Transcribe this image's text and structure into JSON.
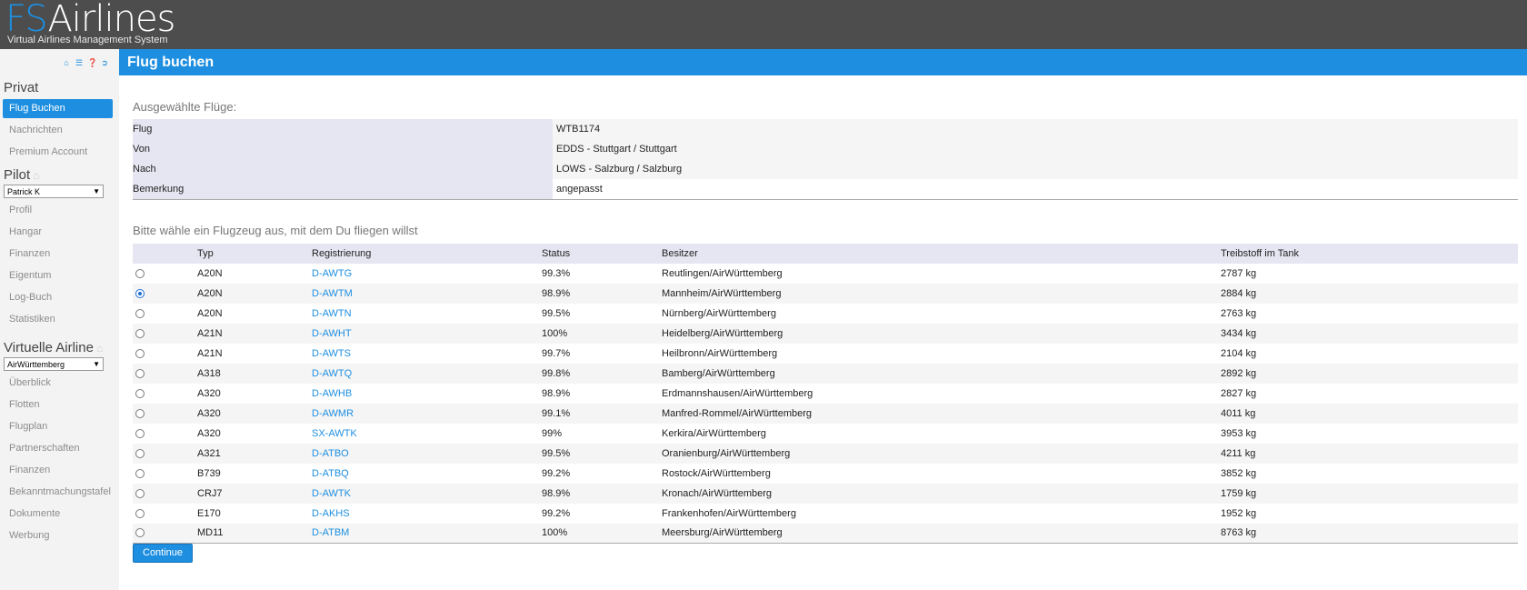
{
  "brand": {
    "prefix": "FS",
    "name": "Airlines",
    "subtitle": "Virtual Airlines Management System"
  },
  "sidebar": {
    "icons": [
      "home-icon",
      "chat-icon",
      "help-icon",
      "logout-icon"
    ],
    "private_title": "Privat",
    "private_items": [
      {
        "label": "Flug Buchen",
        "active": true
      },
      {
        "label": "Nachrichten"
      },
      {
        "label": "Premium Account"
      }
    ],
    "pilot_title": "Pilot",
    "pilot_select": "Patrick K",
    "pilot_items": [
      {
        "label": "Profil"
      },
      {
        "label": "Hangar"
      },
      {
        "label": "Finanzen"
      },
      {
        "label": "Eigentum"
      },
      {
        "label": "Log-Buch"
      },
      {
        "label": "Statistiken"
      }
    ],
    "va_title": "Virtuelle Airline",
    "va_select": "AirWürttemberg",
    "va_items": [
      {
        "label": "Überblick"
      },
      {
        "label": "Flotten"
      },
      {
        "label": "Flugplan"
      },
      {
        "label": "Partnerschaften"
      },
      {
        "label": "Finanzen"
      },
      {
        "label": "Bekanntmachungstafel"
      },
      {
        "label": "Dokumente"
      },
      {
        "label": "Werbung"
      }
    ]
  },
  "page_title": "Flug buchen",
  "selected_flights": {
    "heading": "Ausgewählte Flüge:",
    "rows": [
      {
        "label": "Flug",
        "value": "WTB1174"
      },
      {
        "label": "Von",
        "value": "EDDS - Stuttgart / Stuttgart"
      },
      {
        "label": "Nach",
        "value": "LOWS - Salzburg / Salzburg"
      },
      {
        "label": "Bemerkung",
        "value": "angepasst"
      }
    ]
  },
  "aircraft": {
    "heading": "Bitte wähle ein Flugzeug aus, mit dem Du fliegen willst",
    "columns": [
      "",
      "Typ",
      "Registrierung",
      "Status",
      "Besitzer",
      "Treibstoff im Tank"
    ],
    "rows": [
      {
        "type": "A20N",
        "reg": "D-AWTG",
        "status": "99.3%",
        "owner": "Reutlingen/AirWürttemberg",
        "fuel": "2787 kg",
        "selected": false
      },
      {
        "type": "A20N",
        "reg": "D-AWTM",
        "status": "98.9%",
        "owner": "Mannheim/AirWürttemberg",
        "fuel": "2884 kg",
        "selected": true
      },
      {
        "type": "A20N",
        "reg": "D-AWTN",
        "status": "99.5%",
        "owner": "Nürnberg/AirWürttemberg",
        "fuel": "2763 kg",
        "selected": false
      },
      {
        "type": "A21N",
        "reg": "D-AWHT",
        "status": "100%",
        "owner": "Heidelberg/AirWürttemberg",
        "fuel": "3434 kg",
        "selected": false
      },
      {
        "type": "A21N",
        "reg": "D-AWTS",
        "status": "99.7%",
        "owner": "Heilbronn/AirWürttemberg",
        "fuel": "2104 kg",
        "selected": false
      },
      {
        "type": "A318",
        "reg": "D-AWTQ",
        "status": "99.8%",
        "owner": "Bamberg/AirWürttemberg",
        "fuel": "2892 kg",
        "selected": false
      },
      {
        "type": "A320",
        "reg": "D-AWHB",
        "status": "98.9%",
        "owner": "Erdmannshausen/AirWürttemberg",
        "fuel": "2827 kg",
        "selected": false
      },
      {
        "type": "A320",
        "reg": "D-AWMR",
        "status": "99.1%",
        "owner": "Manfred-Rommel/AirWürttemberg",
        "fuel": "4011 kg",
        "selected": false
      },
      {
        "type": "A320",
        "reg": "SX-AWTK",
        "status": "99%",
        "owner": "Kerkira/AirWürttemberg",
        "fuel": "3953 kg",
        "selected": false
      },
      {
        "type": "A321",
        "reg": "D-ATBO",
        "status": "99.5%",
        "owner": "Oranienburg/AirWürttemberg",
        "fuel": "4211 kg",
        "selected": false
      },
      {
        "type": "B739",
        "reg": "D-ATBQ",
        "status": "99.2%",
        "owner": "Rostock/AirWürttemberg",
        "fuel": "3852 kg",
        "selected": false
      },
      {
        "type": "CRJ7",
        "reg": "D-AWTK",
        "status": "98.9%",
        "owner": "Kronach/AirWürttemberg",
        "fuel": "1759 kg",
        "selected": false
      },
      {
        "type": "E170",
        "reg": "D-AKHS",
        "status": "99.2%",
        "owner": "Frankenhofen/AirWürttemberg",
        "fuel": "1952 kg",
        "selected": false
      },
      {
        "type": "MD11",
        "reg": "D-ATBM",
        "status": "100%",
        "owner": "Meersburg/AirWürttemberg",
        "fuel": "8763 kg",
        "selected": false
      }
    ],
    "continue_label": "Continue"
  },
  "colors": {
    "accent": "#1e8fe0",
    "header_bg": "#4d4d4d",
    "table_header": "#e5e6f1"
  }
}
